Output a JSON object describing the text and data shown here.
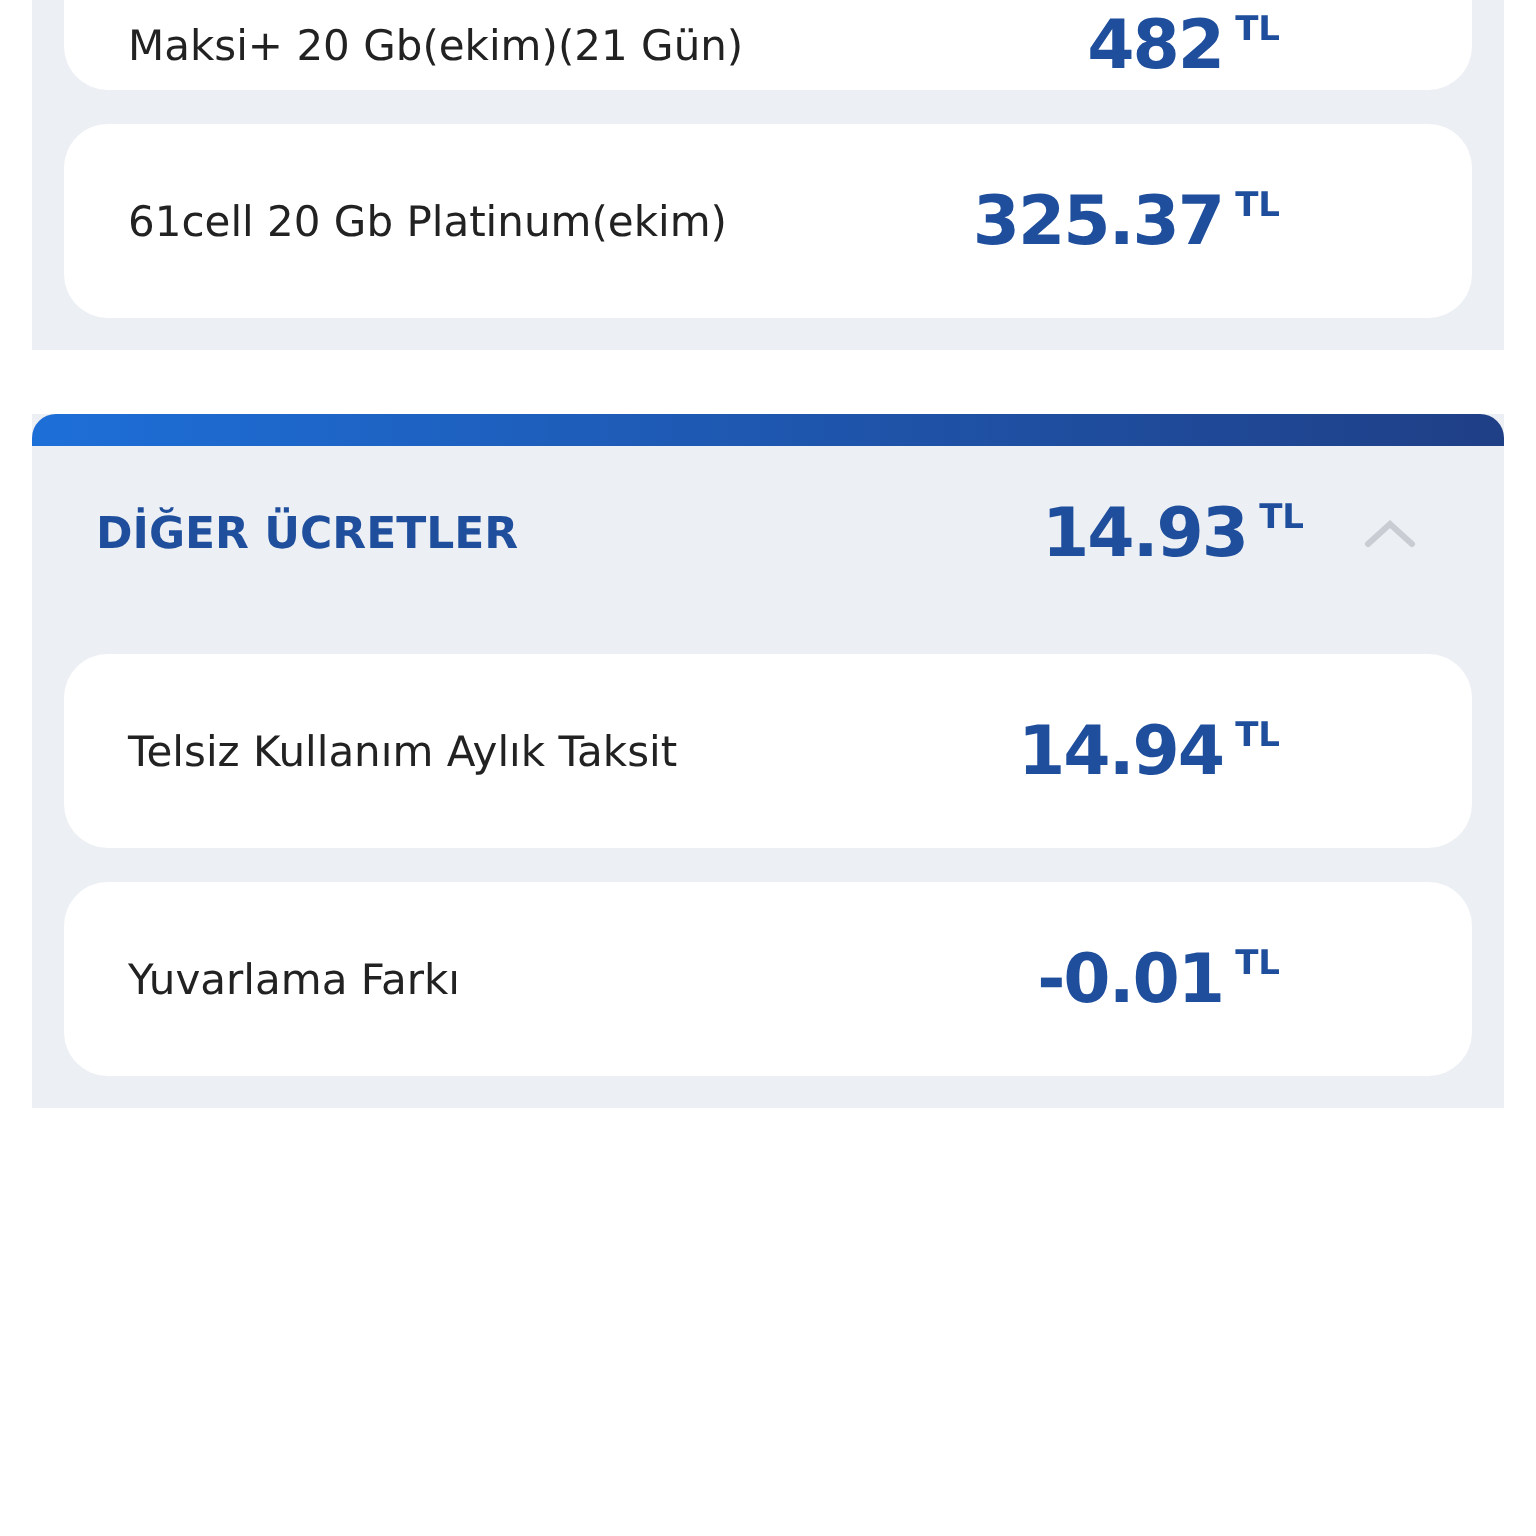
{
  "top_section": {
    "items": [
      {
        "label": "Maksi+ 20 Gb(ekim)(21 Gün)",
        "amount": "482",
        "currency": "TL"
      },
      {
        "label": "61cell 20 Gb Platinum(ekim)",
        "amount": "325.37",
        "currency": "TL"
      }
    ]
  },
  "other_fees": {
    "title": "DİĞER ÜCRETLER",
    "amount": "14.93",
    "currency": "TL",
    "expanded": true,
    "items": [
      {
        "label": "Telsiz Kullanım Aylık Taksit",
        "amount": "14.94",
        "currency": "TL"
      },
      {
        "label": "Yuvarlama Farkı",
        "amount": "-0.01",
        "currency": "TL"
      }
    ]
  }
}
